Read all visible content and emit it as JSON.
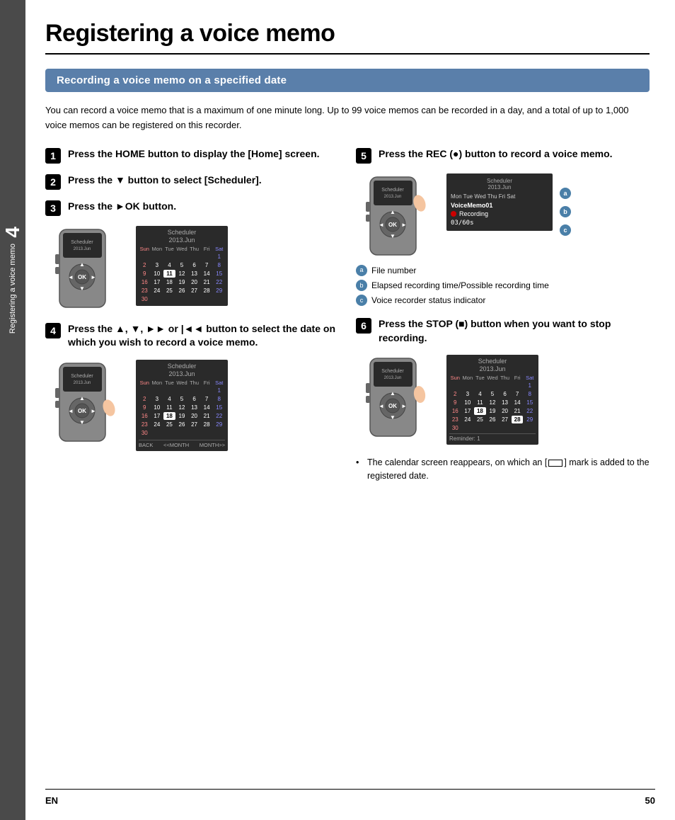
{
  "page": {
    "title": "Registering a voice memo",
    "section_header": "Recording a voice memo on a specified date",
    "intro_text": "You can record a voice memo that is a maximum of one minute long. Up to 99 voice memos can be recorded in a day, and a total of up to 1,000 voice memos can be registered on this recorder.",
    "footer_lang": "EN",
    "footer_page": "50",
    "side_tab_number": "4",
    "side_tab_label": "Registering a voice memo"
  },
  "steps": {
    "step1_text": "Press the HOME button to display the [Home] screen.",
    "step2_text": "Press the ▼ button to select [Scheduler].",
    "step3_text": "Press the ►OK button.",
    "step4_text": "Press the ▲, ▼, ►► or |◄◄ button to select the date on which you wish to record a voice memo.",
    "step5_text": "Press the REC (●) button to record a voice memo.",
    "step6_text": "Press the STOP (■) button when you want to stop recording."
  },
  "annotations": {
    "a_label": "a",
    "b_label": "b",
    "c_label": "c",
    "a_text": "File number",
    "b_text": "Elapsed recording time/Possible recording time",
    "c_text": "Voice recorder status indicator"
  },
  "calendar": {
    "title": "Scheduler",
    "date": "2013.Jun",
    "days_header": [
      "Sun",
      "Mon",
      "Tue",
      "Wed",
      "Thu",
      "Fri",
      "Sat"
    ],
    "rows": [
      [
        "",
        "",
        "",
        "",
        "",
        "",
        "1"
      ],
      [
        "2",
        "3",
        "4",
        "5",
        "6",
        "7",
        "8"
      ],
      [
        "9",
        "10",
        "11",
        "12",
        "13",
        "14",
        "15"
      ],
      [
        "16",
        "17",
        "18",
        "19",
        "20",
        "21",
        "22"
      ],
      [
        "23",
        "24",
        "25",
        "26",
        "27",
        "28",
        "29"
      ],
      [
        "30",
        "",
        "",
        "",
        "",
        "",
        ""
      ]
    ],
    "highlighted_day": "18",
    "footer_back": "BACK",
    "footer_prev": "<<MONTH",
    "footer_next": "MONTH>>"
  },
  "calendar_step6": {
    "title": "Scheduler",
    "date": "2013.Jun",
    "highlighted_day": "18",
    "highlighted_day2": "28",
    "reminder": "Reminder: 1"
  },
  "recording_screen": {
    "title": "Scheduler",
    "date": "2013.Jun",
    "header_row": "Mon Tue Wed...",
    "filename": "VoiceMemo01",
    "status": "Recording",
    "time": "03/60s"
  },
  "bullet_note": "The calendar screen reappears, on which an [     ] mark is added to the registered date."
}
